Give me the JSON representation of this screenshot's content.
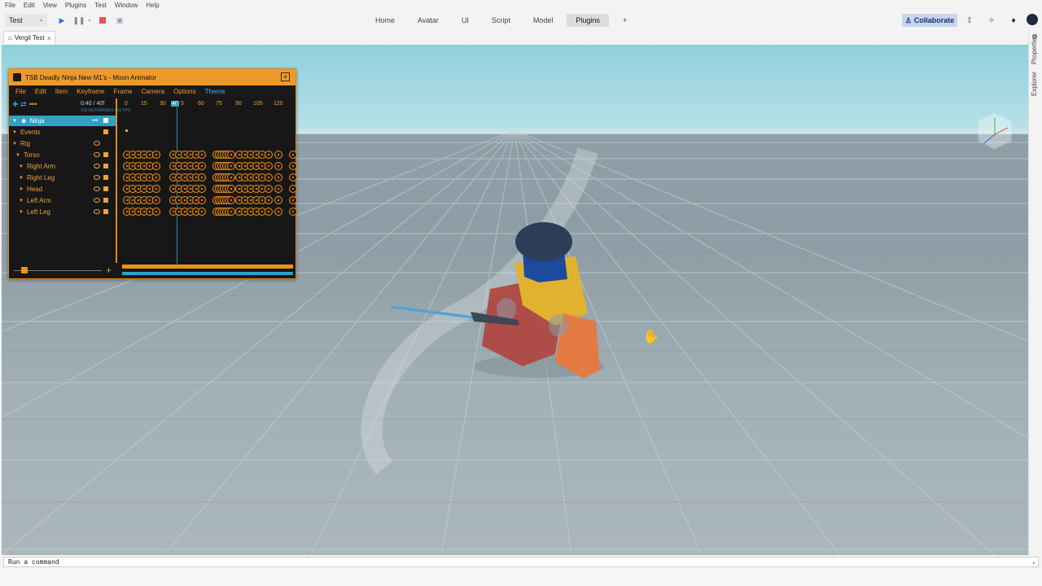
{
  "menu": [
    "File",
    "Edit",
    "View",
    "Plugins",
    "Test",
    "Window",
    "Help"
  ],
  "toolbar": {
    "mode": "Test",
    "tabs": [
      "Home",
      "Avatar",
      "UI",
      "Script",
      "Model",
      "Plugins"
    ],
    "active_tab": "Plugins",
    "add_tab": "+",
    "collaborate": "Collaborate"
  },
  "doc_tab": {
    "label": "Vergil Test"
  },
  "side_panel": {
    "properties": "Properties",
    "explorer": "Explorer"
  },
  "command": {
    "placeholder": "Run a command"
  },
  "colors": {
    "accent_orange": "#ee9a2b",
    "accent_blue": "#2fa2c3",
    "collab_bg": "#c9d5ef"
  },
  "moon_animator": {
    "title": "TSB Deadly Ninja New M1's - Moon Animator",
    "menu": [
      "File",
      "Edit",
      "Item",
      "Keyframe",
      "Frame",
      "Camera",
      "Options",
      "Theme"
    ],
    "counter": "0:40 / 40f",
    "info": "158 KEYFRAMES / 60 FPS",
    "ruler": [
      "0",
      "15",
      "30",
      "40",
      "5",
      "60",
      "75",
      "90",
      "105",
      "120"
    ],
    "tree": [
      "Ninja",
      "Events",
      "Rig",
      "Torso",
      "Right Arm",
      "Right Leg",
      "Head",
      "Left Arm",
      "Left Leg"
    ]
  }
}
